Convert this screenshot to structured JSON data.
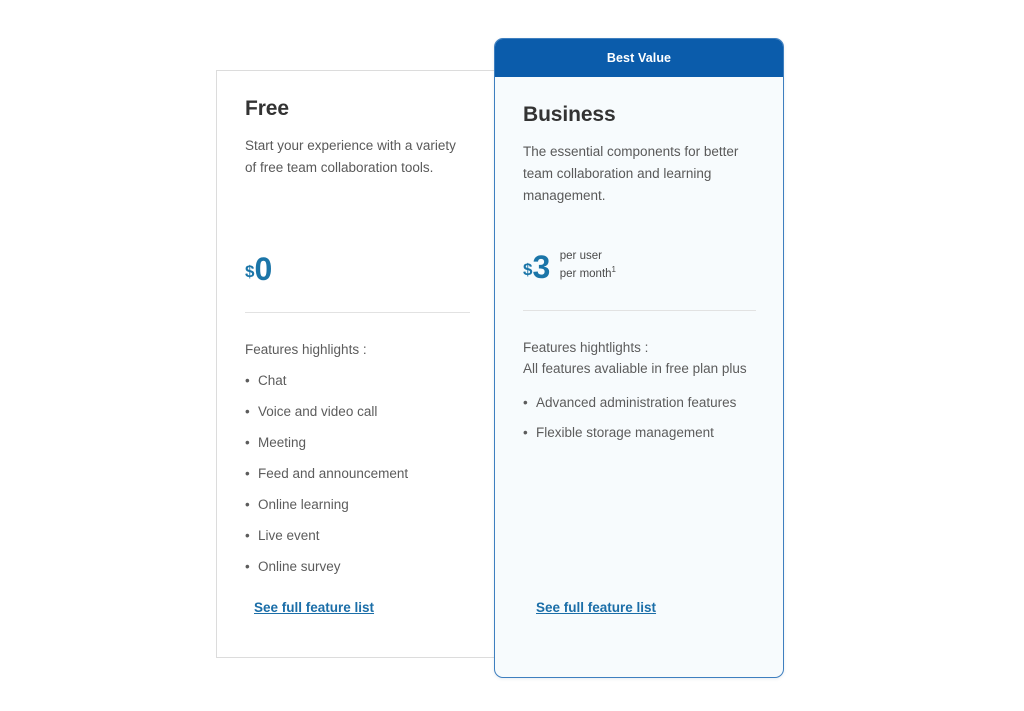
{
  "page": {
    "background_color": "#ffffff",
    "accent_blue": "#0b5cab",
    "price_blue": "#1b75a8",
    "link_blue": "#1b6ea8"
  },
  "plans": [
    {
      "id": "free",
      "name": "Free",
      "description": "Start your experience with a variety of free team collaboration tools.",
      "currency_symbol": "$",
      "price": "0",
      "per_unit_line1": "",
      "per_unit_line2": "",
      "footnote_marker": "",
      "features_heading": "Features highlights :",
      "features_subheading": "",
      "features": [
        "Chat",
        "Voice and video call",
        "Meeting",
        "Feed and announcement",
        "Online learning",
        "Live event",
        "Online survey"
      ],
      "link_label": "See full feature list",
      "badge": ""
    },
    {
      "id": "business",
      "name": "Business",
      "description": "The essential components for better team collaboration and learning management.",
      "currency_symbol": "$",
      "price": "3",
      "per_unit_line1": "per user",
      "per_unit_line2": "per month",
      "footnote_marker": "1",
      "features_heading": "Features hightlights :",
      "features_subheading": "All features avaliable in free plan plus",
      "features": [
        "Advanced administration features",
        "Flexible storage management"
      ],
      "link_label": "See full feature list",
      "badge": "Best Value"
    }
  ],
  "icons": {
    "bullet": "•"
  }
}
